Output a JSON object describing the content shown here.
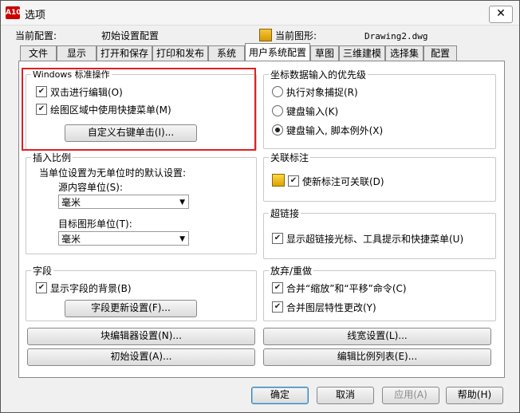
{
  "window": {
    "title": "选项",
    "app_icon": "A10"
  },
  "header": {
    "current_config_label": "当前配置:",
    "current_config_value": "初始设置配置",
    "current_drawing_label": "当前图形:",
    "current_drawing_value": "Drawing2.dwg"
  },
  "tabs": [
    "文件",
    "显示",
    "打开和保存",
    "打印和发布",
    "系统",
    "用户系统配置",
    "草图",
    "三维建模",
    "选择集",
    "配置"
  ],
  "active_tab": "用户系统配置",
  "windows_standard": {
    "title": "Windows 标准操作",
    "double_click_edit": "双击进行编辑(O)",
    "shortcut_menus": "绘图区域中使用快捷菜单(M)",
    "customize_button": "自定义右键单击(I)..."
  },
  "insertion_scale": {
    "title": "插入比例",
    "desc": "当单位设置为无单位时的默认设置:",
    "source_label": "源内容单位(S):",
    "source_value": "毫米",
    "target_label": "目标图形单位(T):",
    "target_value": "毫米"
  },
  "fields": {
    "title": "字段",
    "show_background": "显示字段的背景(B)",
    "update_button": "字段更新设置(F)..."
  },
  "coordinate_priority": {
    "title": "坐标数据输入的优先级",
    "options": [
      "执行对象捕捉(R)",
      "键盘输入(K)",
      "键盘输入, 脚本例外(X)"
    ],
    "selected_index": 2
  },
  "associative_dim": {
    "title": "关联标注",
    "make_associative": "使新标注可关联(D)"
  },
  "hyperlink": {
    "title": "超链接",
    "display": "显示超链接光标、工具提示和快捷菜单(U)"
  },
  "undo_redo": {
    "title": "放弃/重做",
    "combine_zoom_pan": "合并“缩放”和“平移”命令(C)",
    "combine_layer": "合并图层特性更改(Y)"
  },
  "buttons_bottom": {
    "block_editor": "块编辑器设置(N)...",
    "lineweight": "线宽设置(L)...",
    "initial_setup": "初始设置(A)...",
    "scale_list": "编辑比例列表(E)..."
  },
  "footer": {
    "ok": "确定",
    "cancel": "取消",
    "apply": "应用(A)",
    "help": "帮助(H)"
  }
}
